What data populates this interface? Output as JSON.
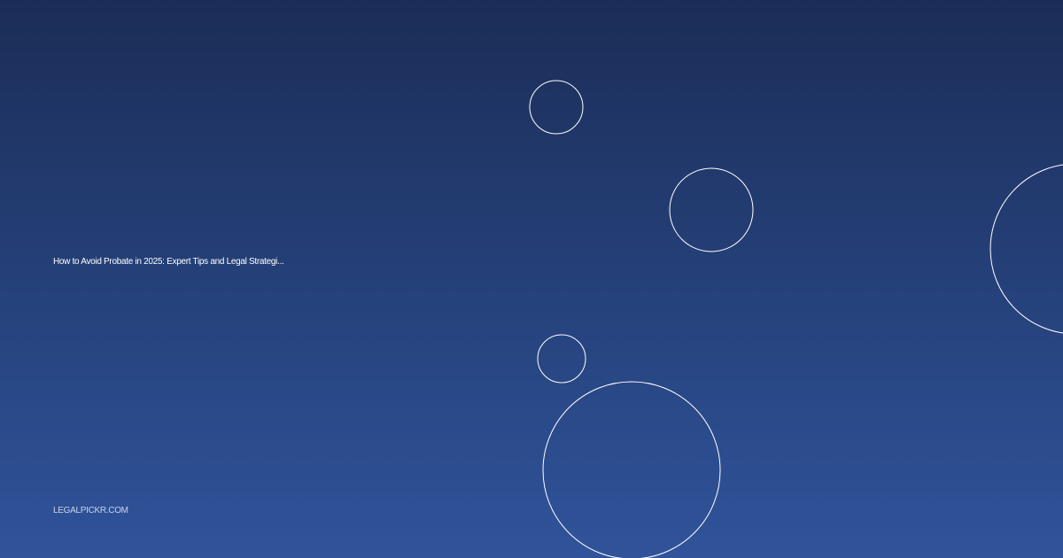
{
  "card": {
    "title": "How to Avoid Probate in 2025: Expert Tips and Legal Strategi...",
    "site": "LEGALPICKR.COM"
  },
  "colors": {
    "background_top": "#1b2d57",
    "background_bottom": "#30539a",
    "circle_stroke": "#ffffff",
    "title_text": "#ffffff",
    "site_text": "#c9d4ec"
  }
}
